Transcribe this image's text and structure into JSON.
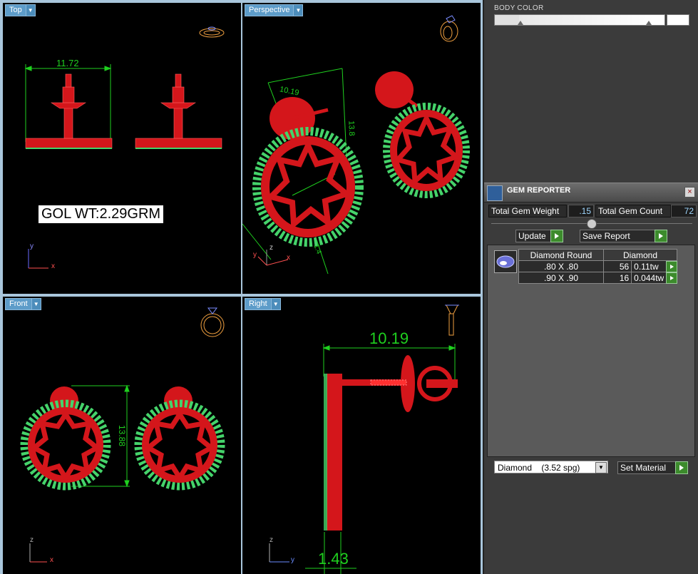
{
  "viewports": {
    "top": {
      "label": "Top",
      "weight_label": "GOL WT:2.29GRM",
      "dimension": "11.72",
      "axis_v": "y",
      "axis_h": "x"
    },
    "perspective": {
      "label": "Perspective",
      "dim_a": "10.19",
      "dim_b": "13.8",
      "dim_c": "1.4",
      "axis_v": "z",
      "axis_h1": "y",
      "axis_h2": "x"
    },
    "front": {
      "label": "Front",
      "dimension": "13.88",
      "axis_v": "z",
      "axis_h": "x"
    },
    "right": {
      "label": "Right",
      "dim_width": "10.19",
      "dim_thickness": "1.43",
      "axis_v": "z",
      "axis_h": "y"
    }
  },
  "body_color": {
    "title": "BODY COLOR"
  },
  "gem_reporter": {
    "title": "GEM REPORTER",
    "total_gem_weight_label": "Total Gem Weight",
    "total_gem_weight": ".15",
    "total_gem_count_label": "Total Gem Count",
    "total_gem_count": "72",
    "update_label": "Update",
    "save_report_label": "Save Report",
    "table": {
      "headers": [
        "Diamond Round",
        "Diamond"
      ],
      "rows": [
        {
          "size": ".80 X .80",
          "count": "56",
          "weight": "0.11tw"
        },
        {
          "size": ".90 X .90",
          "count": "16",
          "weight": "0.044tw"
        }
      ]
    },
    "material_select": "Diamond    (3.52 spg)",
    "set_material_label": "Set Material"
  },
  "colors": {
    "viewport_bg": "#000000",
    "model_red": "#d4161b",
    "gem_green": "#45d36a",
    "gem_blue": "#3fa0e0",
    "dimension_green": "#1fd01f",
    "label_blue": "#5d9cc9",
    "panel_bg": "#3b3b3b"
  },
  "icons": [
    "dropdown-arrow-icon",
    "ring-preview-icon",
    "gem-reporter-icon",
    "close-icon",
    "play-icon",
    "gem-thumbnail-icon",
    "axis-triad-icon"
  ]
}
